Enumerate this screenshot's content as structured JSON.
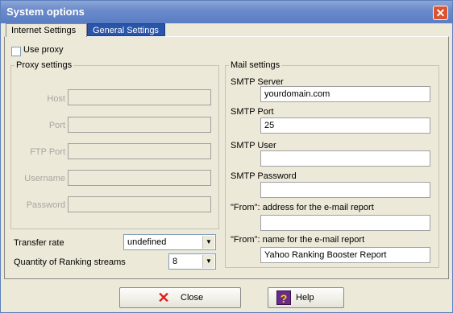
{
  "window": {
    "title": "System options",
    "close_glyph": "✕"
  },
  "tabs": [
    {
      "label": "Internet Settings",
      "active": true
    },
    {
      "label": "General Settings",
      "active": false
    }
  ],
  "use_proxy": {
    "label": "Use proxy",
    "checked": false
  },
  "proxy": {
    "legend": "Proxy settings",
    "host_label": "Host",
    "host_value": "",
    "port_label": "Port",
    "port_value": "",
    "ftp_port_label": "FTP Port",
    "ftp_port_value": "",
    "username_label": "Username",
    "username_value": "",
    "password_label": "Password",
    "password_value": ""
  },
  "transfer": {
    "label": "Transfer rate",
    "value": "undefined"
  },
  "streams": {
    "label": "Quantity of Ranking  streams",
    "value": "8"
  },
  "mail": {
    "legend": "Mail settings",
    "server_label": "SMTP Server",
    "server_value": "yourdomain.com",
    "port_label": "SMTP Port",
    "port_value": "25",
    "user_label": "SMTP User",
    "user_value": "",
    "password_label": "SMTP Password",
    "password_value": "",
    "from_address_label": "\"From\": address for the e-mail report",
    "from_address_value": "",
    "from_name_label": "\"From\": name for the e-mail report",
    "from_name_value": "Yahoo Ranking Booster Report"
  },
  "buttons": {
    "close_label": "Close",
    "close_icon": "red-x-icon",
    "help_label": "Help",
    "help_icon": "question-book-icon"
  },
  "colors": {
    "titlebar": "#6b8bcb",
    "active_tab_bg": "#2a55a8",
    "dialog_bg": "#ece9d8"
  }
}
